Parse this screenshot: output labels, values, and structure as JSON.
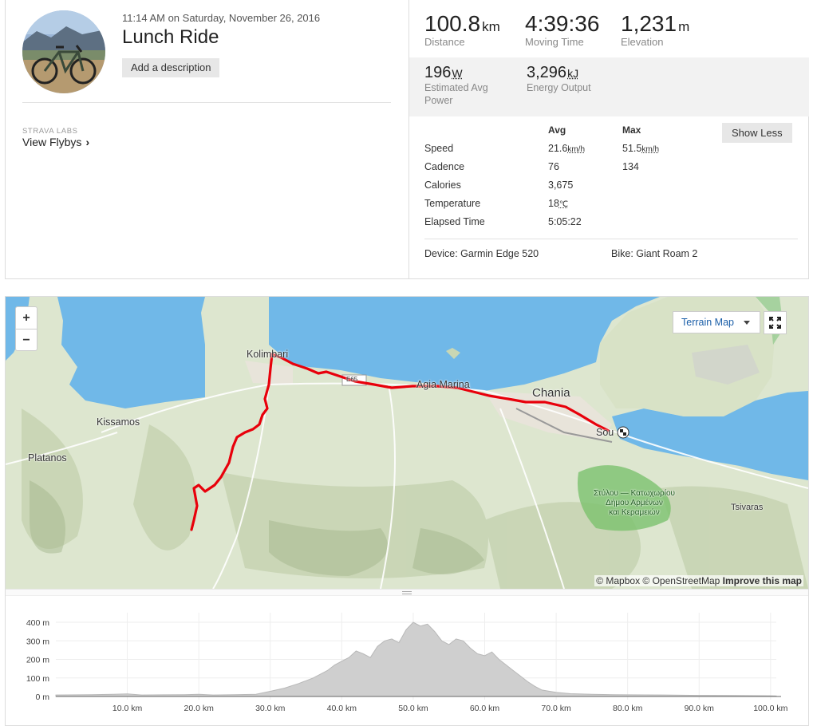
{
  "activity": {
    "datetime": "11:14 AM on Saturday, November 26, 2016",
    "title": "Lunch Ride",
    "add_description_label": "Add a description",
    "labs_label": "STRAVA LABS",
    "flybys_label": "View Flybys"
  },
  "primary_stats": [
    {
      "value": "100.8",
      "unit": "km",
      "label": "Distance"
    },
    {
      "value": "4:39:36",
      "unit": "",
      "label": "Moving Time"
    },
    {
      "value": "1,231",
      "unit": "m",
      "label": "Elevation"
    }
  ],
  "secondary_stats": [
    {
      "value": "196",
      "unit": "W",
      "label": "Estimated Avg Power"
    },
    {
      "value": "3,296",
      "unit": "kJ",
      "label": "Energy Output"
    }
  ],
  "details": {
    "avg_header": "Avg",
    "max_header": "Max",
    "show_less_label": "Show Less",
    "rows": [
      {
        "label": "Speed",
        "avg": "21.6",
        "avg_unit": "km/h",
        "max": "51.5",
        "max_unit": "km/h"
      },
      {
        "label": "Cadence",
        "avg": "76",
        "avg_unit": "",
        "max": "134",
        "max_unit": ""
      },
      {
        "label": "Calories",
        "avg": "3,675",
        "avg_unit": "",
        "max": "",
        "max_unit": ""
      },
      {
        "label": "Temperature",
        "avg": "18",
        "avg_unit": "℃",
        "max": "",
        "max_unit": ""
      },
      {
        "label": "Elapsed Time",
        "avg": "5:05:22",
        "avg_unit": "",
        "max": "",
        "max_unit": ""
      }
    ],
    "device": "Device: Garmin Edge 520",
    "bike": "Bike: Giant Roam 2"
  },
  "map": {
    "zoom_in": "+",
    "zoom_out": "−",
    "layer_label": "Terrain Map",
    "places": {
      "kolimbari": "Kolimbari",
      "kissamos": "Kissamos",
      "platanos": "Platanos",
      "agia_marina": "Agia Marina",
      "chania": "Chania",
      "souda": "Sou",
      "tsivaras": "Tsivaras",
      "reserve_1": "Στύλου — Κατωχωρίου",
      "reserve_2": "Δήμου Αρμένων",
      "reserve_3": "και Κεραμειών",
      "road": "E65"
    },
    "attribution_prefix": "© Mapbox © OpenStreetMap ",
    "attribution_link": "Improve this map",
    "colors": {
      "sea": "#70b8e8",
      "land": "#dde6cf",
      "route": "#e8000b"
    }
  },
  "elevation": {
    "y_ticks": [
      "400 m",
      "300 m",
      "200 m",
      "100 m",
      "0 m"
    ],
    "x_ticks": [
      "10.0 km",
      "20.0 km",
      "30.0 km",
      "40.0 km",
      "50.0 km",
      "60.0 km",
      "70.0 km",
      "80.0 km",
      "90.0 km",
      "100.0 km"
    ],
    "profile_km_m": [
      [
        0,
        8
      ],
      [
        5,
        10
      ],
      [
        8,
        12
      ],
      [
        10,
        14
      ],
      [
        12,
        8
      ],
      [
        15,
        9
      ],
      [
        18,
        10
      ],
      [
        20,
        12
      ],
      [
        22,
        8
      ],
      [
        25,
        10
      ],
      [
        28,
        12
      ],
      [
        30,
        28
      ],
      [
        32,
        45
      ],
      [
        34,
        70
      ],
      [
        36,
        100
      ],
      [
        38,
        140
      ],
      [
        39,
        170
      ],
      [
        40,
        190
      ],
      [
        41,
        210
      ],
      [
        42,
        245
      ],
      [
        43,
        230
      ],
      [
        44,
        210
      ],
      [
        45,
        270
      ],
      [
        46,
        300
      ],
      [
        47,
        310
      ],
      [
        48,
        290
      ],
      [
        49,
        360
      ],
      [
        50,
        400
      ],
      [
        51,
        380
      ],
      [
        52,
        390
      ],
      [
        53,
        350
      ],
      [
        54,
        300
      ],
      [
        55,
        280
      ],
      [
        56,
        310
      ],
      [
        57,
        300
      ],
      [
        58,
        260
      ],
      [
        59,
        230
      ],
      [
        60,
        220
      ],
      [
        61,
        240
      ],
      [
        62,
        200
      ],
      [
        63,
        170
      ],
      [
        64,
        140
      ],
      [
        65,
        110
      ],
      [
        66,
        80
      ],
      [
        67,
        55
      ],
      [
        68,
        35
      ],
      [
        70,
        22
      ],
      [
        72,
        15
      ],
      [
        75,
        12
      ],
      [
        78,
        10
      ],
      [
        80,
        9
      ],
      [
        85,
        8
      ],
      [
        90,
        6
      ],
      [
        95,
        5
      ],
      [
        100,
        4
      ],
      [
        100.8,
        3
      ]
    ]
  }
}
